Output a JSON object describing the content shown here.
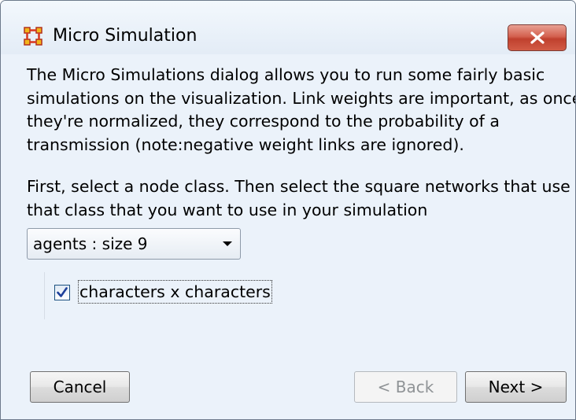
{
  "window": {
    "title": "Micro Simulation",
    "icon": "grid-network-icon",
    "close_icon": "close-icon",
    "close_color": "#c9483a"
  },
  "description": {
    "paragraph1": [
      "The Micro Simulations dialog allows you to run some fairly basic",
      "simulations on the visualization. Link weights are important, as once",
      "they're normalized, they correspond to the probability of a",
      "transmission (note:negative weight links are ignored)."
    ],
    "paragraph2": [
      "First, select a node class. Then select the square networks that use",
      "that class that you want to use in your simulation"
    ]
  },
  "node_class_select": {
    "value": "agents : size 9",
    "icon": "chevron-down-icon"
  },
  "networks": [
    {
      "label": "characters x characters",
      "checked": true
    }
  ],
  "buttons": {
    "cancel": "Cancel",
    "back": "< Back",
    "back_enabled": false,
    "next": "Next >"
  }
}
